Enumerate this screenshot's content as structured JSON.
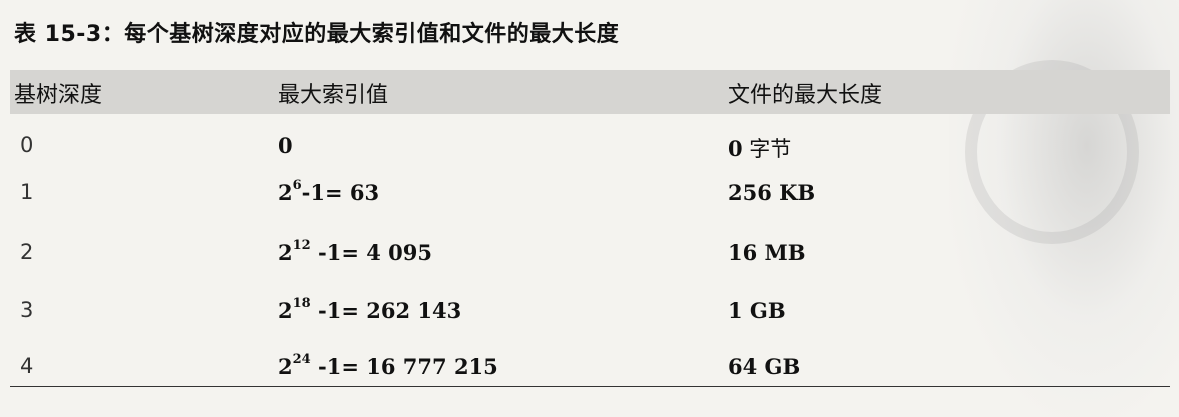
{
  "caption": "表 15-3：每个基树深度对应的最大索引值和文件的最大长度",
  "table": {
    "headers": [
      "基树深度",
      "最大索引值",
      "文件的最大长度"
    ],
    "rows": [
      {
        "depth": "0",
        "index_base": "0",
        "index_exp": "",
        "index_rest": "",
        "size": "0",
        "size_unit": " 字节"
      },
      {
        "depth": "1",
        "index_base": "2",
        "index_exp": "6",
        "index_rest": "-1= 63",
        "size": "256 KB",
        "size_unit": ""
      },
      {
        "depth": "2",
        "index_base": "2",
        "index_exp": "12",
        "index_rest": " -1= 4 095",
        "size": "16 MB",
        "size_unit": ""
      },
      {
        "depth": "3",
        "index_base": "2",
        "index_exp": "18",
        "index_rest": " -1= 262 143",
        "size": "1 GB",
        "size_unit": ""
      },
      {
        "depth": "4",
        "index_base": "2",
        "index_exp": "24",
        "index_rest": " -1= 16 777 215",
        "size": "64 GB",
        "size_unit": ""
      }
    ]
  }
}
